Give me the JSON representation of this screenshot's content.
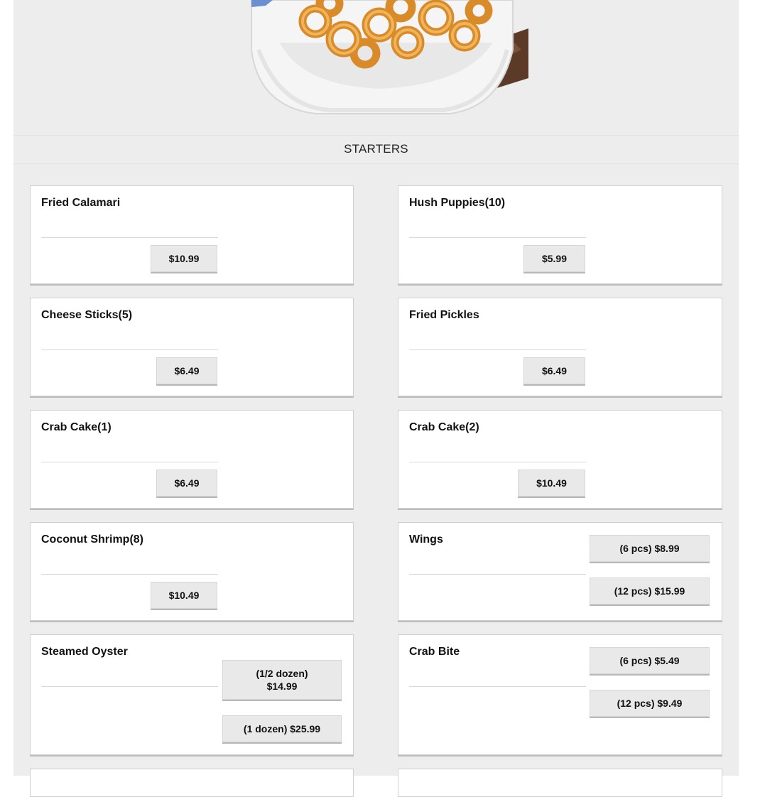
{
  "section": {
    "title": "STARTERS"
  },
  "hero": {
    "image": "fried-calamari-dish-image"
  },
  "items": [
    {
      "name": "Fried Calamari",
      "prices": [
        "$10.99"
      ]
    },
    {
      "name": "Hush Puppies(10)",
      "prices": [
        "$5.99"
      ]
    },
    {
      "name": "Cheese Sticks(5)",
      "prices": [
        "$6.49"
      ]
    },
    {
      "name": "Fried Pickles",
      "prices": [
        "$6.49"
      ]
    },
    {
      "name": "Crab Cake(1)",
      "prices": [
        "$6.49"
      ]
    },
    {
      "name": "Crab Cake(2)",
      "prices": [
        "$10.49"
      ]
    },
    {
      "name": "Coconut Shrimp(8)",
      "prices": [
        "$10.49"
      ]
    },
    {
      "name": "Wings",
      "prices": [
        "(6 pcs) $8.99",
        "(12 pcs) $15.99"
      ]
    },
    {
      "name": "Steamed Oyster",
      "prices": [
        "(1/2 dozen)\n$14.99",
        "(1 dozen) $25.99"
      ]
    },
    {
      "name": "Crab Bite",
      "prices": [
        "(6 pcs) $5.49",
        "(12 pcs) $9.49"
      ]
    }
  ]
}
